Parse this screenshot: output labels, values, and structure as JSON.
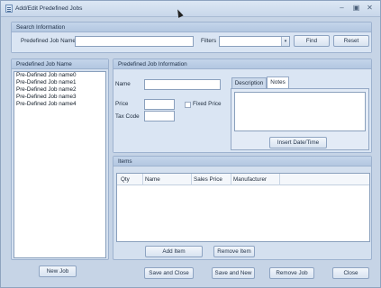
{
  "window": {
    "title": "Add/Edit Predefined Jobs",
    "minimize_glyph": "‒",
    "restore_glyph": "▣",
    "close_glyph": "✕"
  },
  "search": {
    "header": "Search Information",
    "job_name_label": "Predefined Job Name",
    "job_name_value": "",
    "filters_label": "Filters",
    "filters_value": "",
    "dropdown_glyph": "▾",
    "find_label": "Find",
    "reset_label": "Reset"
  },
  "job_list": {
    "header": "Predefined Job Name",
    "items": [
      "Pre-Defined Job name0",
      "Pre-Defined Job name1",
      "Pre-Defined Job name2",
      "Pre-Defined Job name3",
      "Pre-Defined Job name4"
    ],
    "new_job_label": "New Job"
  },
  "job_info": {
    "header": "Predefined Job Information",
    "name_label": "Name",
    "name_value": "",
    "price_label": "Price",
    "price_value": "",
    "fixed_price_label": "Fixed Price",
    "tax_code_label": "Tax Code",
    "tax_code_value": "",
    "tabs": [
      "Description",
      "Notes"
    ],
    "notes_value": "",
    "insert_date_label": "Insert Date/Time"
  },
  "items": {
    "header": "Items",
    "columns": [
      "Qty",
      "Name",
      "Sales Price",
      "Manufacturer"
    ],
    "add_item_label": "Add Item",
    "remove_item_label": "Remove Item"
  },
  "footer": {
    "save_close_label": "Save and Close",
    "save_new_label": "Save and New",
    "remove_job_label": "Remove Job",
    "close_label": "Close"
  },
  "colors": {
    "window_bg": "#c6d4e6",
    "panel_bg": "#dae5f3",
    "header_bg": "#b3c7e1",
    "border": "#8aa0bd"
  }
}
